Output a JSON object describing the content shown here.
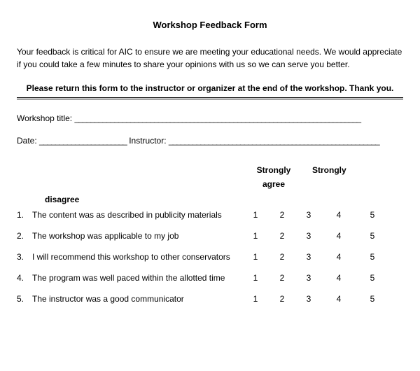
{
  "title": "Workshop Feedback Form",
  "intro": "Your feedback is critical for AIC to ensure we are meeting your educational needs.  We would appreciate if you could take a few minutes to share your opinions with us so we can serve you better.",
  "return_instruction": "Please return this form to the instructor or organizer at the end of the workshop.  Thank you.",
  "fields": {
    "workshop_title_label": "Workshop title:",
    "workshop_title_line": "________________________________________________________________________",
    "date_label": "Date:",
    "date_line": "______________________",
    "instructor_label": "Instructor:",
    "instructor_line": "_____________________________________________________"
  },
  "scale_headers": {
    "strongly": "Strongly",
    "agree": "agree",
    "disagree": "disagree"
  },
  "questions": [
    {
      "num": "1.",
      "text": "The content was as described in publicity materials"
    },
    {
      "num": "2.",
      "text": "The workshop was applicable to my job"
    },
    {
      "num": "3.",
      "text": "I will recommend this workshop to other conservators"
    },
    {
      "num": "4.",
      "text": "The program was well paced within the allotted time"
    },
    {
      "num": "5.",
      "text": "The instructor was a good communicator"
    }
  ],
  "scale_values": [
    "1",
    "2",
    "3",
    "4",
    "5"
  ]
}
